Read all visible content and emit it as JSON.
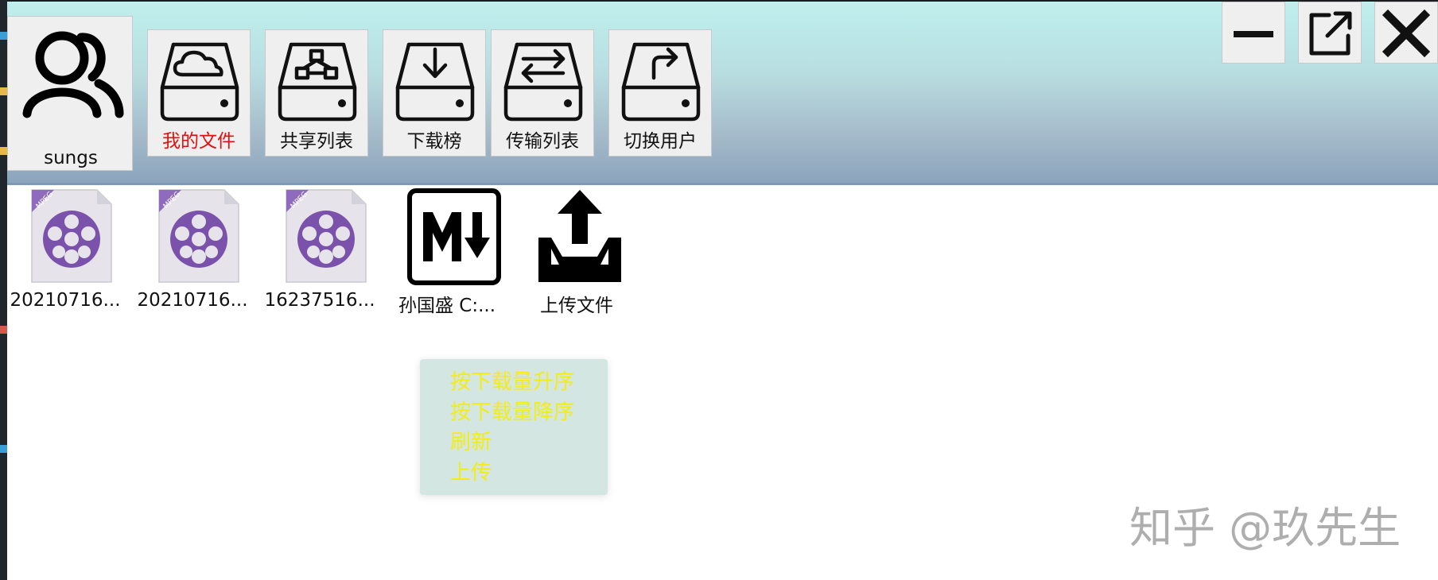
{
  "user": {
    "name": "sungs"
  },
  "nav": {
    "items": [
      {
        "label": "我的文件",
        "icon": "cloud-drive-icon",
        "active": true
      },
      {
        "label": "共享列表",
        "icon": "share-drive-icon",
        "active": false
      },
      {
        "label": "下载榜",
        "icon": "download-drive-icon",
        "active": false
      },
      {
        "label": "传输列表",
        "icon": "transfer-drive-icon",
        "active": false
      },
      {
        "label": "切换用户",
        "icon": "switch-drive-icon",
        "active": false
      }
    ]
  },
  "window_controls": [
    "minimize-icon",
    "restore-icon",
    "close-icon"
  ],
  "files": [
    {
      "name": "20210716...",
      "icon": "mpeg-file-icon"
    },
    {
      "name": "20210716...",
      "icon": "mpeg-file-icon"
    },
    {
      "name": "16237516...",
      "icon": "mpeg-file-icon"
    },
    {
      "name": "孙国盛 C:...",
      "icon": "markdown-file-icon"
    },
    {
      "name": "上传文件",
      "icon": "upload-icon"
    }
  ],
  "context_menu": {
    "items": [
      "按下载量升序",
      "按下载量降序",
      "刷新",
      "上传"
    ]
  },
  "watermark": "知乎 @玖先生",
  "colors": {
    "active_nav_text": "#e01010",
    "menu_text": "#f3ec17",
    "menu_bg": "#d3e6e1",
    "mpeg_purple": "#7b52ab"
  }
}
